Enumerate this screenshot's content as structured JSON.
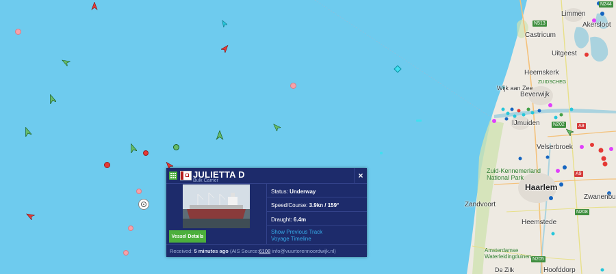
{
  "popup": {
    "vessel_name": "JULIETTA D",
    "vessel_type": "Bulk Carrier",
    "close_symbol": "×",
    "details_button": "Vessel Details",
    "status": {
      "label": "Status:",
      "value": "Underway"
    },
    "speed_course": {
      "label": "Speed/Course:",
      "value": "3.9kn / 159°"
    },
    "draught": {
      "label": "Draught:",
      "value": "6.4m"
    },
    "show_track": "Show Previous Track",
    "voyage_timeline": "Voyage Timeline",
    "received_label": "Received:",
    "received_value": "5 minutes ago",
    "ais_source_prefix": "(AIS Source:",
    "ais_source_id": "6108",
    "ais_source_suffix": "info@vuurtorennoordwijk.nl)"
  },
  "places": {
    "limmen": "Limmen",
    "akersloot": "Akersloot",
    "castricum": "Castricum",
    "uitgeest": "Uitgeest",
    "heemskerk": "Heemskerk",
    "wijk_aan_zee": "Wijk aan Zee",
    "beverwijk": "Beverwijk",
    "ijmuiden": "IJmuiden",
    "velserbroek": "Velserbroek",
    "zuid_kennemerland": "Zuid-Kennemerland National Park",
    "haarlem": "Haarlem",
    "zwanenburg": "Zwanenburg",
    "zandvoort": "Zandvoort",
    "heemstede": "Heemstede",
    "amsterdamse_waterleidingduinen": "Amsterdamse Waterleidingduinen",
    "de_zilk": "De Zilk",
    "hoofddorp": "Hoofddorp",
    "zuidscheg": "ZUIDSCHEG"
  },
  "roads": {
    "n244": "N244",
    "n513": "N513",
    "n202": "N202",
    "a9": "A9",
    "n208": "N208",
    "n205": "N205"
  },
  "colors": {
    "sea": "#6ecbee",
    "popup_bg": "#1d2b6b",
    "link": "#36a9e6",
    "details_button": "#4caf3c"
  }
}
